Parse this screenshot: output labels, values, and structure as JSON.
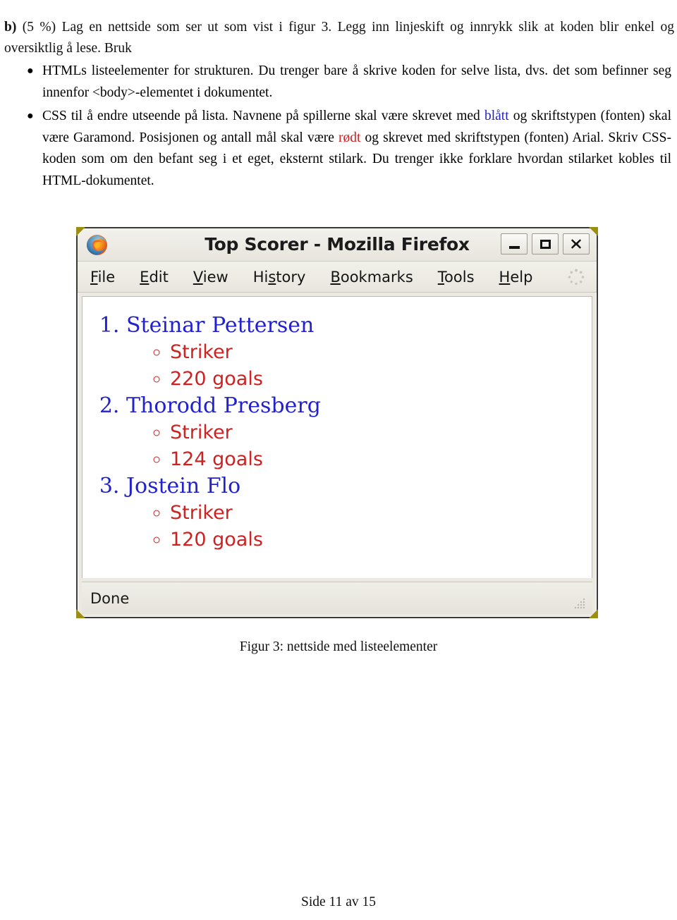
{
  "document": {
    "intro": {
      "label": "b)",
      "text": " (5 %) Lag en nettside som ser ut som vist i figur 3. Legg inn linjeskift og innrykk slik at koden blir enkel og oversiktlig å lese. Bruk"
    },
    "bullets": [
      {
        "marker": "●",
        "text": "HTMLs listeelementer for strukturen. Du trenger bare å skrive koden for selve lista, dvs. det som befinner seg innenfor <body>-elementet i dokumentet."
      },
      {
        "marker": "●",
        "part1": "CSS til å endre utseende på lista. Navnene på spillerne skal være skrevet med ",
        "blue_word": "blått",
        "part2": " og skriftstypen (fonten) skal være Garamond. Posisjonen og antall mål skal være ",
        "red_word": "rødt",
        "part3": " og skrevet med skriftstypen (fonten) Arial. Skriv CSS-koden som om den befant seg i et eget, eksternt stilark. Du trenger ikke forklare hvordan stilarket kobles til HTML-dokumentet."
      }
    ],
    "figure_caption": "Figur 3: nettside med listeelementer",
    "footer": "Side 11 av 15"
  },
  "browser": {
    "window_title": "Top Scorer - Mozilla Firefox",
    "logo_icon": "firefox-logo-icon",
    "controls": [
      {
        "name": "minimize-button",
        "glyph": "–"
      },
      {
        "name": "maximize-button",
        "glyph": "□"
      },
      {
        "name": "close-button",
        "glyph": "✕"
      }
    ],
    "menu": [
      {
        "label": "File",
        "accel": "F"
      },
      {
        "label": "Edit",
        "accel": "E"
      },
      {
        "label": "View",
        "accel": "V"
      },
      {
        "label": "History",
        "accel": "s"
      },
      {
        "label": "Bookmarks",
        "accel": "B"
      },
      {
        "label": "Tools",
        "accel": "T"
      },
      {
        "label": "Help",
        "accel": "H"
      }
    ],
    "throbber_icon": "loading-spinner-icon",
    "status_text": "Done",
    "resize_grip_icon": "resize-grip-icon"
  },
  "webpage": {
    "list_type": "ordered",
    "players": [
      {
        "rank": "1.",
        "name": "Steinar Pettersen",
        "details": [
          "Striker",
          "220 goals"
        ]
      },
      {
        "rank": "2.",
        "name": "Thorodd Presberg",
        "details": [
          "Striker",
          "124 goals"
        ]
      },
      {
        "rank": "3.",
        "name": "Jostein Flo",
        "details": [
          "Striker",
          "120 goals"
        ]
      }
    ]
  },
  "colors": {
    "name_blue": "#2222cc",
    "detail_red": "#cc2222",
    "window_frame": "#3a3a38",
    "frame_accent": "#9a8f12",
    "chrome_bg": "#ece9e3"
  }
}
